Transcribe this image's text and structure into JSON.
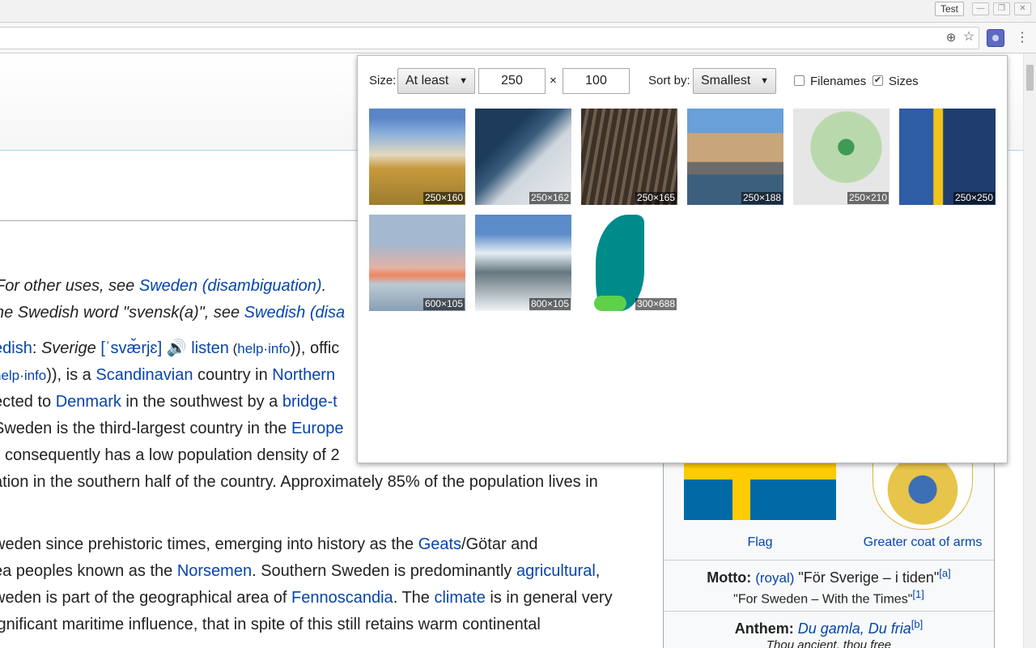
{
  "browser": {
    "profile_button": "Test",
    "window_controls": {
      "minimize": "—",
      "maximize": "❐",
      "close": "✕"
    }
  },
  "article": {
    "hatnote1": {
      "prefix": "For other uses, see ",
      "link": "Sweden (disambiguation)",
      "suffix": "."
    },
    "hatnote2": {
      "prefix": "he Swedish word \"svensk(a)\", see ",
      "link": "Swedish (disa"
    },
    "lines": {
      "l1": {
        "a": "edish",
        "b": ": ",
        "c": "Sverige",
        "d": " ",
        "e": "[ˈsvæ̌rjɛ]",
        "f": " ",
        "g": "listen",
        "h": " (",
        "i": "help",
        "j": "·",
        "k": "info",
        "l": ")), offic"
      },
      "l2": {
        "a": "help",
        "b": "·",
        "c": "info",
        "d": ")), is a ",
        "e": "Scandinavian",
        "f": " country in ",
        "g": "Northern"
      },
      "l3": {
        "a": "ected to ",
        "b": "Denmark",
        "c": " in the southwest by a ",
        "d": "bridge-t"
      },
      "l4": {
        "a": "Sweden is the third-largest country in the ",
        "b": "Europe"
      },
      "l5": {
        "a": "consequently has a low population density of 2"
      },
      "l6": {
        "a": "ation in the southern half of the country. Approximately 85% of the population lives in"
      },
      "l7": {
        "a": "weden since prehistoric times, emerging into history as the ",
        "b": "Geats",
        "c": "/Götar and"
      },
      "l8": {
        "a": "ea peoples known as the ",
        "b": "Norsemen",
        "c": ". Southern Sweden is predominantly ",
        "d": "agricultural",
        "e": ","
      },
      "l9": {
        "a": "weden is part of the geographical area of ",
        "b": "Fennoscandia",
        "c": ". The ",
        "d": "climate",
        "e": " is in general very"
      },
      "l10": {
        "a": "ignificant maritime influence, that in spite of this still retains warm continental"
      }
    }
  },
  "infobox": {
    "flag_caption": "Flag",
    "coat_caption": "Greater coat of arms",
    "motto_label": "Motto:",
    "motto_royal": "(royal)",
    "motto_text": "\"För Sverige – i tiden\"",
    "motto_ref": "[a]",
    "motto_en": "\"For Sweden – With the Times\"",
    "motto_en_ref": "[1]",
    "anthem_label": "Anthem:",
    "anthem_link": "Du gamla, Du fria",
    "anthem_ref": "[b]",
    "anthem_sub": "Thou ancient, thou free"
  },
  "popup": {
    "size_label": "Size:",
    "size_mode": "At least",
    "min_width": "250",
    "times_sign": "×",
    "min_height": "100",
    "sort_label": "Sort by:",
    "sort_mode": "Smallest",
    "filenames_label": "Filenames",
    "filenames_checked": false,
    "sizes_label": "Sizes",
    "sizes_checked": true,
    "images": [
      {
        "size": "250×160"
      },
      {
        "size": "250×162"
      },
      {
        "size": "250×165"
      },
      {
        "size": "250×188"
      },
      {
        "size": "250×210"
      },
      {
        "size": "250×250"
      },
      {
        "size": "600×105"
      },
      {
        "size": "800×105"
      },
      {
        "size": "300×688"
      }
    ]
  },
  "colors": {
    "link": "#0645ad",
    "extension_accent": "#5c6bc0",
    "flag_blue": "#006aa7",
    "flag_yellow": "#fecc00"
  }
}
